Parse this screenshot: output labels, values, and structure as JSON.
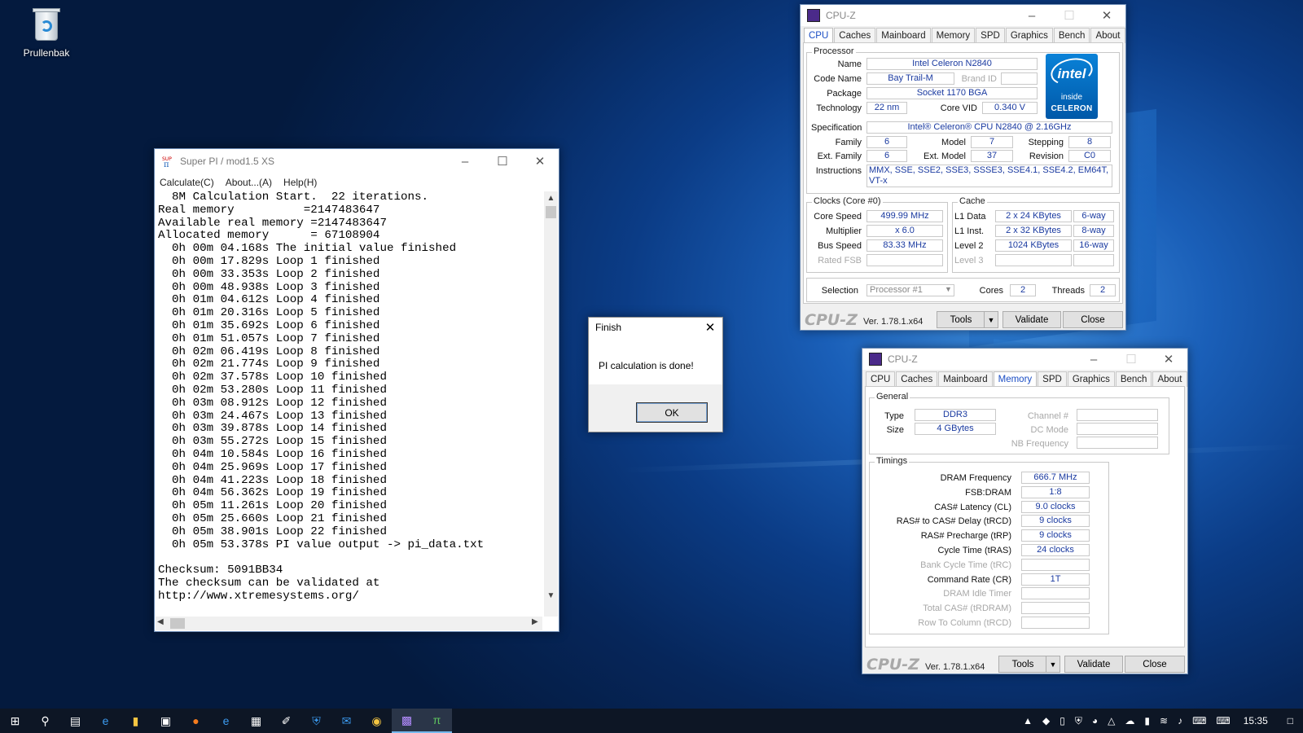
{
  "desktop": {
    "recycle_bin_label": "Prullenbak"
  },
  "superpi": {
    "title": "Super PI / mod1.5 XS",
    "menu": [
      "Calculate(C)",
      "About...(A)",
      "Help(H)"
    ],
    "lines": [
      "  8M Calculation Start.  22 iterations.",
      "Real memory          =2147483647",
      "Available real memory =2147483647",
      "Allocated memory      = 67108904",
      "  0h 00m 04.168s The initial value finished",
      "  0h 00m 17.829s Loop 1 finished",
      "  0h 00m 33.353s Loop 2 finished",
      "  0h 00m 48.938s Loop 3 finished",
      "  0h 01m 04.612s Loop 4 finished",
      "  0h 01m 20.316s Loop 5 finished",
      "  0h 01m 35.692s Loop 6 finished",
      "  0h 01m 51.057s Loop 7 finished",
      "  0h 02m 06.419s Loop 8 finished",
      "  0h 02m 21.774s Loop 9 finished",
      "  0h 02m 37.578s Loop 10 finished",
      "  0h 02m 53.280s Loop 11 finished",
      "  0h 03m 08.912s Loop 12 finished",
      "  0h 03m 24.467s Loop 13 finished",
      "  0h 03m 39.878s Loop 14 finished",
      "  0h 03m 55.272s Loop 15 finished",
      "  0h 04m 10.584s Loop 16 finished",
      "  0h 04m 25.969s Loop 17 finished",
      "  0h 04m 41.223s Loop 18 finished",
      "  0h 04m 56.362s Loop 19 finished",
      "  0h 05m 11.261s Loop 20 finished",
      "  0h 05m 25.660s Loop 21 finished",
      "  0h 05m 38.901s Loop 22 finished",
      "  0h 05m 53.378s PI value output -> pi_data.txt",
      "",
      "Checksum: 5091BB34",
      "The checksum can be validated at",
      "http://www.xtremesystems.org/"
    ]
  },
  "finish_dialog": {
    "title": "Finish",
    "message": "PI calculation is done!",
    "ok_label": "OK"
  },
  "cpuz_cpu": {
    "title": "CPU-Z",
    "tabs": [
      "CPU",
      "Caches",
      "Mainboard",
      "Memory",
      "SPD",
      "Graphics",
      "Bench",
      "About"
    ],
    "processor_group": "Processor",
    "name_label": "Name",
    "name": "Intel Celeron N2840",
    "codename_label": "Code Name",
    "codename": "Bay Trail-M",
    "brandid_label": "Brand ID",
    "brandid": "",
    "package_label": "Package",
    "package": "Socket 1170 BGA",
    "technology_label": "Technology",
    "technology": "22 nm",
    "corevid_label": "Core VID",
    "corevid": "0.340 V",
    "spec_label": "Specification",
    "spec": "Intel® Celeron® CPU  N2840  @ 2.16GHz",
    "family_label": "Family",
    "family": "6",
    "model_label": "Model",
    "model": "7",
    "stepping_label": "Stepping",
    "stepping": "8",
    "extfamily_label": "Ext. Family",
    "extfamily": "6",
    "extmodel_label": "Ext. Model",
    "extmodel": "37",
    "revision_label": "Revision",
    "revision": "C0",
    "instr_label": "Instructions",
    "instr": "MMX, SSE, SSE2, SSE3, SSSE3, SSE4.1, SSE4.2, EM64T, VT-x",
    "clocks_group": "Clocks (Core #0)",
    "corespeed_label": "Core Speed",
    "corespeed": "499.99 MHz",
    "multiplier_label": "Multiplier",
    "multiplier": "x 6.0",
    "busspeed_label": "Bus Speed",
    "busspeed": "83.33 MHz",
    "ratedfsb_label": "Rated FSB",
    "ratedfsb": "",
    "cache_group": "Cache",
    "l1d_label": "L1 Data",
    "l1d": "2 x 24 KBytes",
    "l1d_way": "6-way",
    "l1i_label": "L1 Inst.",
    "l1i": "2 x 32 KBytes",
    "l1i_way": "8-way",
    "l2_label": "Level 2",
    "l2": "1024 KBytes",
    "l2_way": "16-way",
    "l3_label": "Level 3",
    "l3": "",
    "l3_way": "",
    "selection_label": "Selection",
    "selection": "Processor #1",
    "cores_label": "Cores",
    "cores": "2",
    "threads_label": "Threads",
    "threads": "2",
    "logo": "CPU-Z",
    "version": "Ver. 1.78.1.x64",
    "tools_label": "Tools",
    "validate_label": "Validate",
    "close_label": "Close",
    "intel_badge": {
      "brand": "intel",
      "inside": "inside",
      "line": "CELERON",
      "color": "#0071c5"
    }
  },
  "cpuz_mem": {
    "title": "CPU-Z",
    "tabs": [
      "CPU",
      "Caches",
      "Mainboard",
      "Memory",
      "SPD",
      "Graphics",
      "Bench",
      "About"
    ],
    "general_group": "General",
    "type_label": "Type",
    "type": "DDR3",
    "size_label": "Size",
    "size": "4 GBytes",
    "channel_label": "Channel #",
    "channel": "",
    "dcmode_label": "DC Mode",
    "dcmode": "",
    "nbfreq_label": "NB Frequency",
    "nbfreq": "",
    "timings_group": "Timings",
    "timings": [
      {
        "label": "DRAM Frequency",
        "value": "666.7 MHz",
        "dim": false
      },
      {
        "label": "FSB:DRAM",
        "value": "1:8",
        "dim": false
      },
      {
        "label": "CAS# Latency (CL)",
        "value": "9.0 clocks",
        "dim": false
      },
      {
        "label": "RAS# to CAS# Delay (tRCD)",
        "value": "9 clocks",
        "dim": false
      },
      {
        "label": "RAS# Precharge (tRP)",
        "value": "9 clocks",
        "dim": false
      },
      {
        "label": "Cycle Time (tRAS)",
        "value": "24 clocks",
        "dim": false
      },
      {
        "label": "Bank Cycle Time (tRC)",
        "value": "",
        "dim": true
      },
      {
        "label": "Command Rate (CR)",
        "value": "1T",
        "dim": false
      },
      {
        "label": "DRAM Idle Timer",
        "value": "",
        "dim": true
      },
      {
        "label": "Total CAS# (tRDRAM)",
        "value": "",
        "dim": true
      },
      {
        "label": "Row To Column (tRCD)",
        "value": "",
        "dim": true
      }
    ],
    "logo": "CPU-Z",
    "version": "Ver. 1.78.1.x64",
    "tools_label": "Tools",
    "validate_label": "Validate",
    "close_label": "Close"
  },
  "taskbar": {
    "icons": [
      "windows-icon",
      "search-icon",
      "task-view-icon",
      "edge-icon",
      "file-explorer-icon",
      "store-icon",
      "firefox-icon",
      "ie-icon",
      "calculator-icon",
      "paint-icon",
      "security-icon",
      "outlook-icon",
      "chrome-icon",
      "cpuz-icon",
      "superpi-icon"
    ],
    "clock": "15:35"
  },
  "colors": {
    "accent": "#1a4dc4",
    "value_text": "#1a3aa0",
    "taskbar": "#0d1625"
  }
}
